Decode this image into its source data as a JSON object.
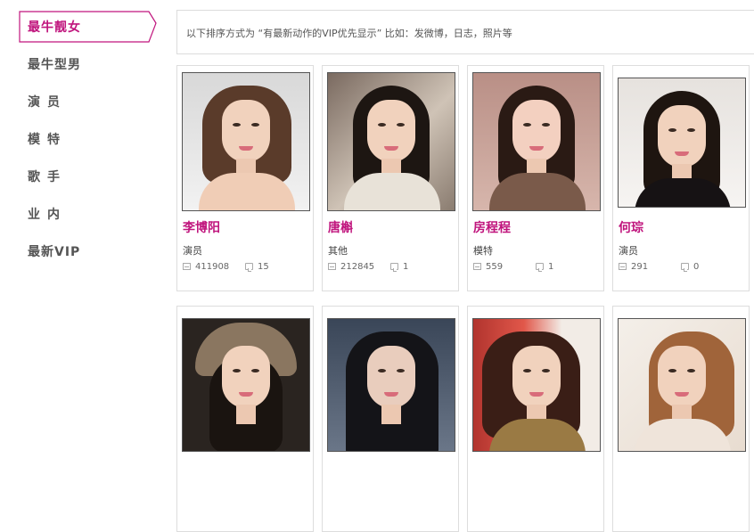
{
  "sidebar": {
    "items": [
      {
        "label": "最牛靓女",
        "active": true
      },
      {
        "label": "最牛型男",
        "active": false
      },
      {
        "label": "演员",
        "active": false
      },
      {
        "label": "模特",
        "active": false
      },
      {
        "label": "歌手",
        "active": false
      },
      {
        "label": "业内",
        "active": false
      },
      {
        "label": "最新VIP",
        "active": false
      }
    ]
  },
  "info": {
    "text": "以下排序方式为 “有最新动作的VIP优先显示” 比如：发微博，日志，照片等"
  },
  "cards": [
    {
      "name": "李博阳",
      "category": "演员",
      "views": "411908",
      "comments": "15"
    },
    {
      "name": "唐槲",
      "category": "其他",
      "views": "212845",
      "comments": "1"
    },
    {
      "name": "房程程",
      "category": "模特",
      "views": "559",
      "comments": "1"
    },
    {
      "name": "何琮",
      "category": "演员",
      "views": "291",
      "comments": "0"
    },
    {
      "name": "",
      "category": "",
      "views": "",
      "comments": ""
    },
    {
      "name": "",
      "category": "",
      "views": "",
      "comments": ""
    },
    {
      "name": "",
      "category": "",
      "views": "",
      "comments": ""
    },
    {
      "name": "",
      "category": "",
      "views": "",
      "comments": ""
    }
  ],
  "colors": {
    "accent": "#c0157d",
    "border": "#dddddd"
  },
  "icons": {
    "views": "document-icon",
    "comments": "comment-icon"
  }
}
